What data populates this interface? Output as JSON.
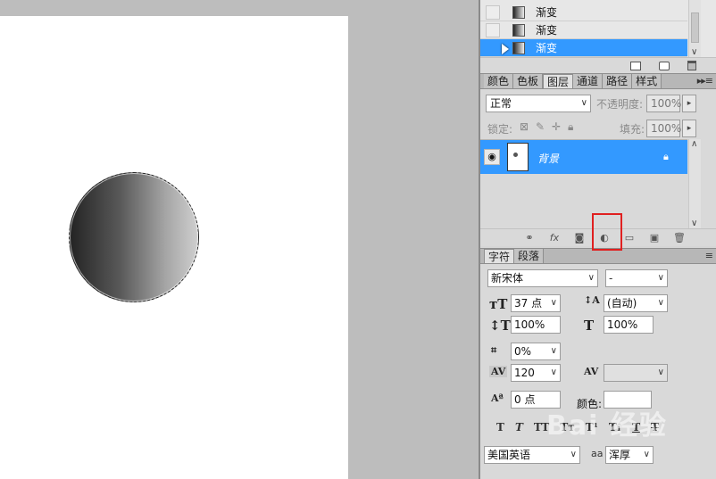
{
  "history": {
    "items": [
      {
        "label": "渐变",
        "selected": false
      },
      {
        "label": "渐变",
        "selected": false
      },
      {
        "label": "渐变",
        "selected": true
      }
    ]
  },
  "layers_tabs": [
    {
      "label": "颜色",
      "active": false
    },
    {
      "label": "色板",
      "active": false
    },
    {
      "label": "图层",
      "active": true
    },
    {
      "label": "通道",
      "active": false
    },
    {
      "label": "路径",
      "active": false
    },
    {
      "label": "样式",
      "active": false
    }
  ],
  "layers": {
    "blend_mode": "正常",
    "opacity_label": "不透明度:",
    "opacity_value": "100%",
    "lock_label": "锁定:",
    "fill_label": "填充:",
    "fill_value": "100%",
    "layer_name": "背景",
    "footer_fx": "fx"
  },
  "character_tabs": [
    {
      "label": "字符",
      "active": true
    },
    {
      "label": "段落",
      "active": false
    }
  ],
  "character": {
    "font_family": "新宋体",
    "font_style": "-",
    "font_size": "37 点",
    "leading": "(自动)",
    "vertical_scale": "100%",
    "horizontal_scale": "100%",
    "tracking_shift": "0%",
    "tracking": "120",
    "kerning": "",
    "baseline_shift": "0 点",
    "color_label": "颜色:",
    "language": "美国英语",
    "antialias_label": "aa",
    "antialias": "浑厚"
  },
  "watermark": "Bai 经验"
}
